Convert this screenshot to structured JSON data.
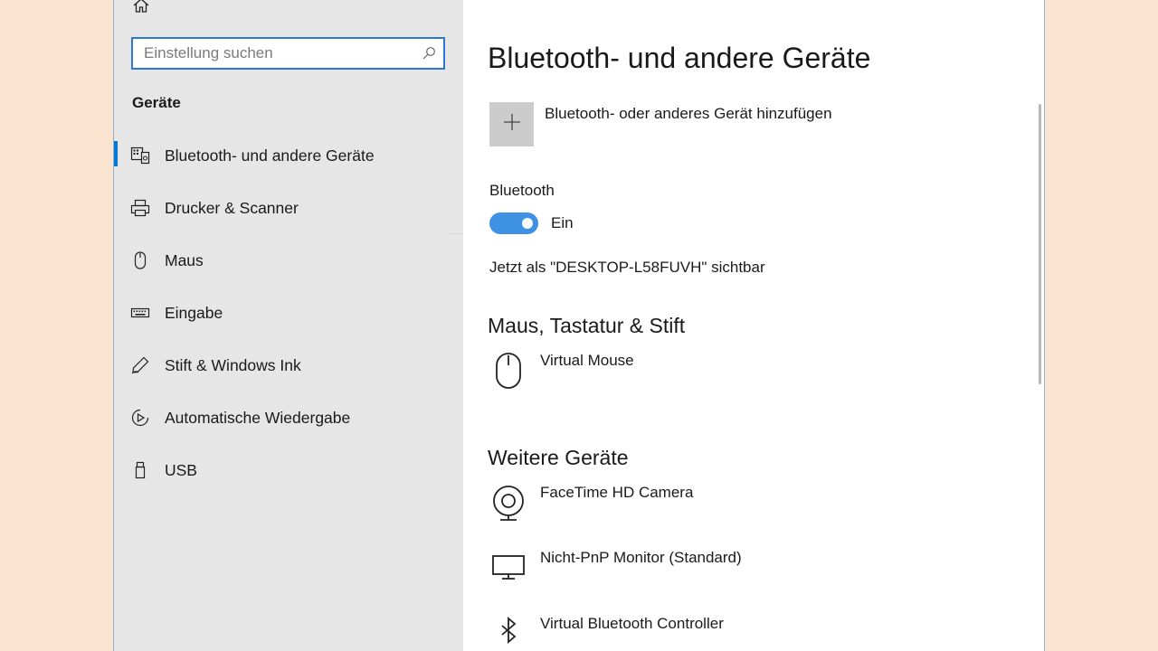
{
  "search": {
    "placeholder": "Einstellung suchen"
  },
  "sidebar": {
    "section_title": "Geräte",
    "items": [
      {
        "label": "Bluetooth- und andere Geräte",
        "icon": "bluetooth-devices-icon",
        "active": true
      },
      {
        "label": "Drucker & Scanner",
        "icon": "printer-icon"
      },
      {
        "label": "Maus",
        "icon": "mouse-icon"
      },
      {
        "label": "Eingabe",
        "icon": "keyboard-icon"
      },
      {
        "label": "Stift & Windows Ink",
        "icon": "pen-icon"
      },
      {
        "label": "Automatische Wiedergabe",
        "icon": "autoplay-icon"
      },
      {
        "label": "USB",
        "icon": "usb-icon"
      }
    ]
  },
  "main": {
    "title": "Bluetooth- und andere Geräte",
    "add_device_label": "Bluetooth- oder anderes Gerät hinzufügen",
    "bluetooth_label": "Bluetooth",
    "toggle_state": "Ein",
    "visibility_text": "Jetzt als \"DESKTOP-L58FUVH\" sichtbar",
    "section_mouse": {
      "title": "Maus, Tastatur & Stift",
      "devices": [
        {
          "label": "Virtual Mouse",
          "icon": "mouse-icon"
        }
      ]
    },
    "section_other": {
      "title": "Weitere Geräte",
      "devices": [
        {
          "label": "FaceTime HD Camera",
          "icon": "webcam-icon"
        },
        {
          "label": "Nicht-PnP Monitor (Standard)",
          "icon": "monitor-icon"
        },
        {
          "label": "Virtual Bluetooth Controller",
          "icon": "bluetooth-icon"
        }
      ]
    }
  },
  "colors": {
    "accent": "#0078d7",
    "toggle_on": "#3f91e4",
    "sidebar_bg": "#e6e6e6",
    "page_bg": "#fce5d0"
  }
}
